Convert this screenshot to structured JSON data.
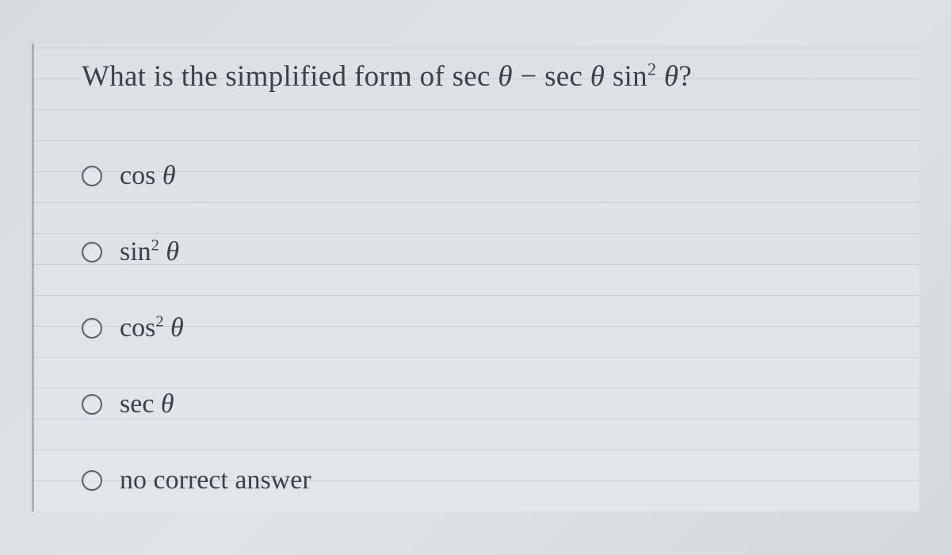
{
  "question": {
    "prefix": "What is the simplified form of ",
    "expr_part1": "sec",
    "theta": "θ",
    "minus": " − ",
    "expr_part2": "sec",
    "sin": "sin",
    "sup": "2",
    "qmark": "?"
  },
  "options": [
    {
      "fn": "cos",
      "sup": "",
      "theta": "θ"
    },
    {
      "fn": "sin",
      "sup": "2",
      "theta": "θ"
    },
    {
      "fn": "cos",
      "sup": "2",
      "theta": "θ"
    },
    {
      "fn": "sec",
      "sup": "",
      "theta": "θ"
    },
    {
      "text": "no correct answer"
    }
  ]
}
